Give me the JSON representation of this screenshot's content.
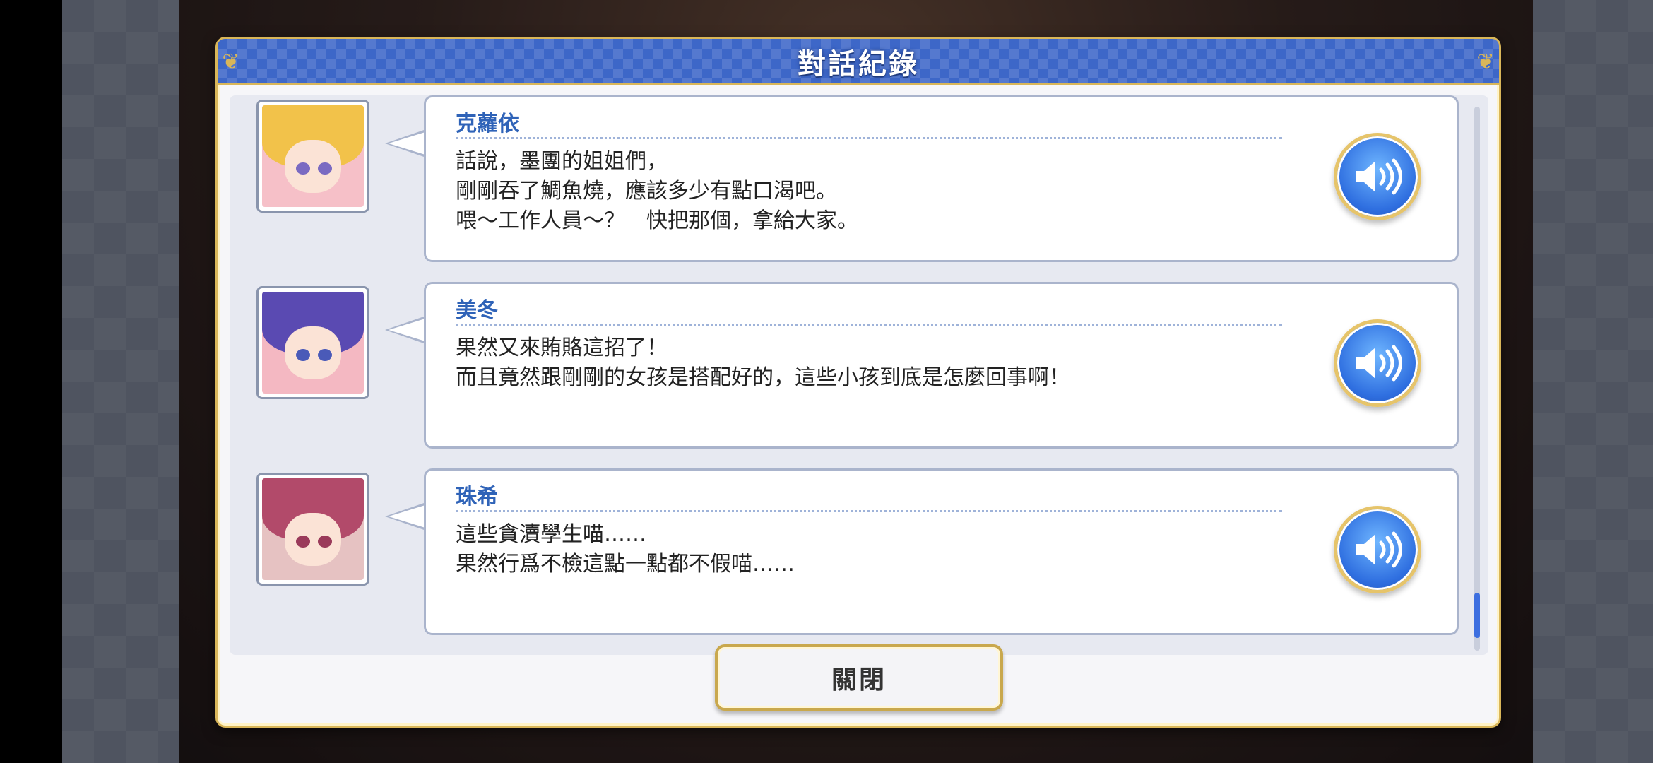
{
  "dialog": {
    "title": "對話紀錄",
    "close_label": "關閉"
  },
  "colors": {
    "title_bar": "#3d67c8",
    "gold_border": "#d9b659",
    "speaker_name": "#2f63b8",
    "scroll_thumb": "#3d6fe0"
  },
  "entries": [
    {
      "speaker": "克蘿依",
      "lines": [
        "話說，墨團的姐姐們，",
        "剛剛吞了鯛魚燒，應該多少有點口渴吧。",
        "喂～工作人員～？　快把那個，拿給大家。"
      ],
      "portrait_icon": "character-portrait-blonde"
    },
    {
      "speaker": "美冬",
      "lines": [
        "果然又來賄賂這招了！",
        "而且竟然跟剛剛的女孩是搭配好的，這些小孩到底是怎麼回事啊！"
      ],
      "portrait_icon": "character-portrait-purple-hair"
    },
    {
      "speaker": "珠希",
      "lines": [
        "這些貪瀆學生喵……",
        "果然行爲不檢這點一點都不假喵……"
      ],
      "portrait_icon": "character-portrait-pink-hair"
    }
  ],
  "icons": {
    "voice": "speaker-volume-icon"
  }
}
